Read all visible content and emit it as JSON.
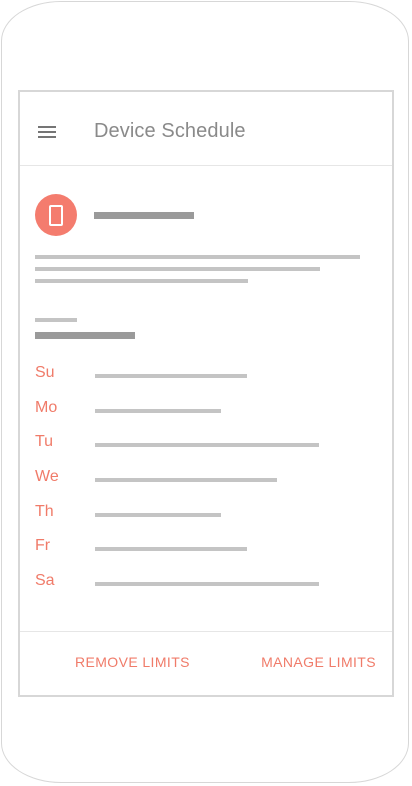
{
  "app": {
    "title": "Device Schedule"
  },
  "colors": {
    "accent": "#f07b69",
    "avatar_bg": "#f47c6e",
    "placeholder_gray": "#c4c4c4",
    "placeholder_dark": "#9a9a9a"
  },
  "icons": {
    "menu": "menu-icon",
    "device": "phone-icon"
  },
  "schedule": {
    "days": [
      {
        "label": "Su"
      },
      {
        "label": "Mo"
      },
      {
        "label": "Tu"
      },
      {
        "label": "We"
      },
      {
        "label": "Th"
      },
      {
        "label": "Fr"
      },
      {
        "label": "Sa"
      }
    ]
  },
  "footer": {
    "remove_label": "REMOVE LIMITS",
    "manage_label": "MANAGE LIMITS"
  }
}
